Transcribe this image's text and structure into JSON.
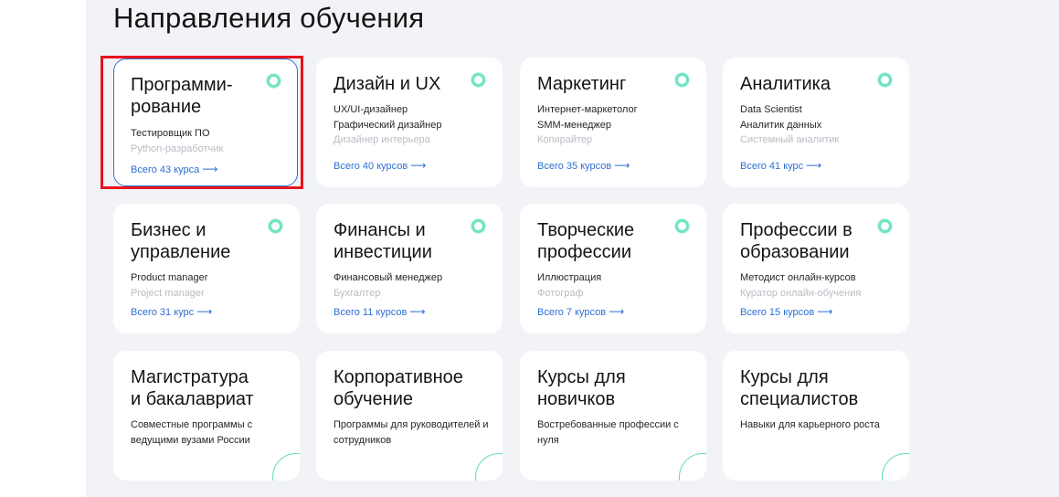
{
  "section_title": "Направления обучения",
  "colors": {
    "accent_blue": "#2d6fd4",
    "teal": "#6fe3c2",
    "highlight_red": "#e6141e",
    "background": "#f2f3f7"
  },
  "cards": [
    {
      "title": "Программи-\nрование",
      "subs": [
        "Тестировщик ПО",
        "Python-разработчик"
      ],
      "link": "Всего 43 курса",
      "icon": "teal-dot-icon"
    },
    {
      "title": "Дизайн и UX",
      "subs": [
        "UX/UI-дизайнер",
        "Графический дизайнер",
        "Дизайнер интерьера"
      ],
      "link": "Всего 40 курсов",
      "icon": "teal-dot-icon"
    },
    {
      "title": "Маркетинг",
      "subs": [
        "Интернет-маркетолог",
        "SMM-менеджер",
        "Копирайтер"
      ],
      "link": "Всего 35 курсов",
      "icon": "teal-dot-icon"
    },
    {
      "title": "Аналитика",
      "subs": [
        "Data Scientist",
        "Аналитик данных",
        "Системный аналитик"
      ],
      "link": "Всего 41 курс",
      "icon": "teal-dot-icon"
    },
    {
      "title": "Бизнес и\nуправление",
      "subs": [
        "Product manager",
        "Project manager"
      ],
      "link": "Всего 31 курс",
      "icon": "teal-dot-icon"
    },
    {
      "title": "Финансы и\nинвестиции",
      "subs": [
        "Финансовый менеджер",
        "Бухгалтер"
      ],
      "link": "Всего 11 курсов",
      "icon": "teal-dot-icon"
    },
    {
      "title": "Творческие\nпрофессии",
      "subs": [
        "Иллюстрация",
        "Фотограф"
      ],
      "link": "Всего 7 курсов",
      "icon": "teal-dot-icon"
    },
    {
      "title": "Профессии в\nобразовании",
      "subs": [
        "Методист онлайн-курсов",
        "Куратор онлайн-обучения"
      ],
      "link": "Всего 15 курсов",
      "icon": "teal-dot-icon"
    },
    {
      "title": "Магистратура\nи бакалавриат",
      "desc": "Совместные программы с ведущими вузами России",
      "icon": "arc-decoration-icon"
    },
    {
      "title": "Корпоративное\nобучение",
      "desc": "Программы для руководителей и сотрудников",
      "icon": "arc-decoration-icon"
    },
    {
      "title": "Курсы для\nновичков",
      "desc": "Востребованные профессии с нуля",
      "icon": "arc-decoration-icon"
    },
    {
      "title": "Курсы для\nспециалистов",
      "desc": "Навыки для карьерного роста",
      "icon": "arc-decoration-icon"
    }
  ]
}
